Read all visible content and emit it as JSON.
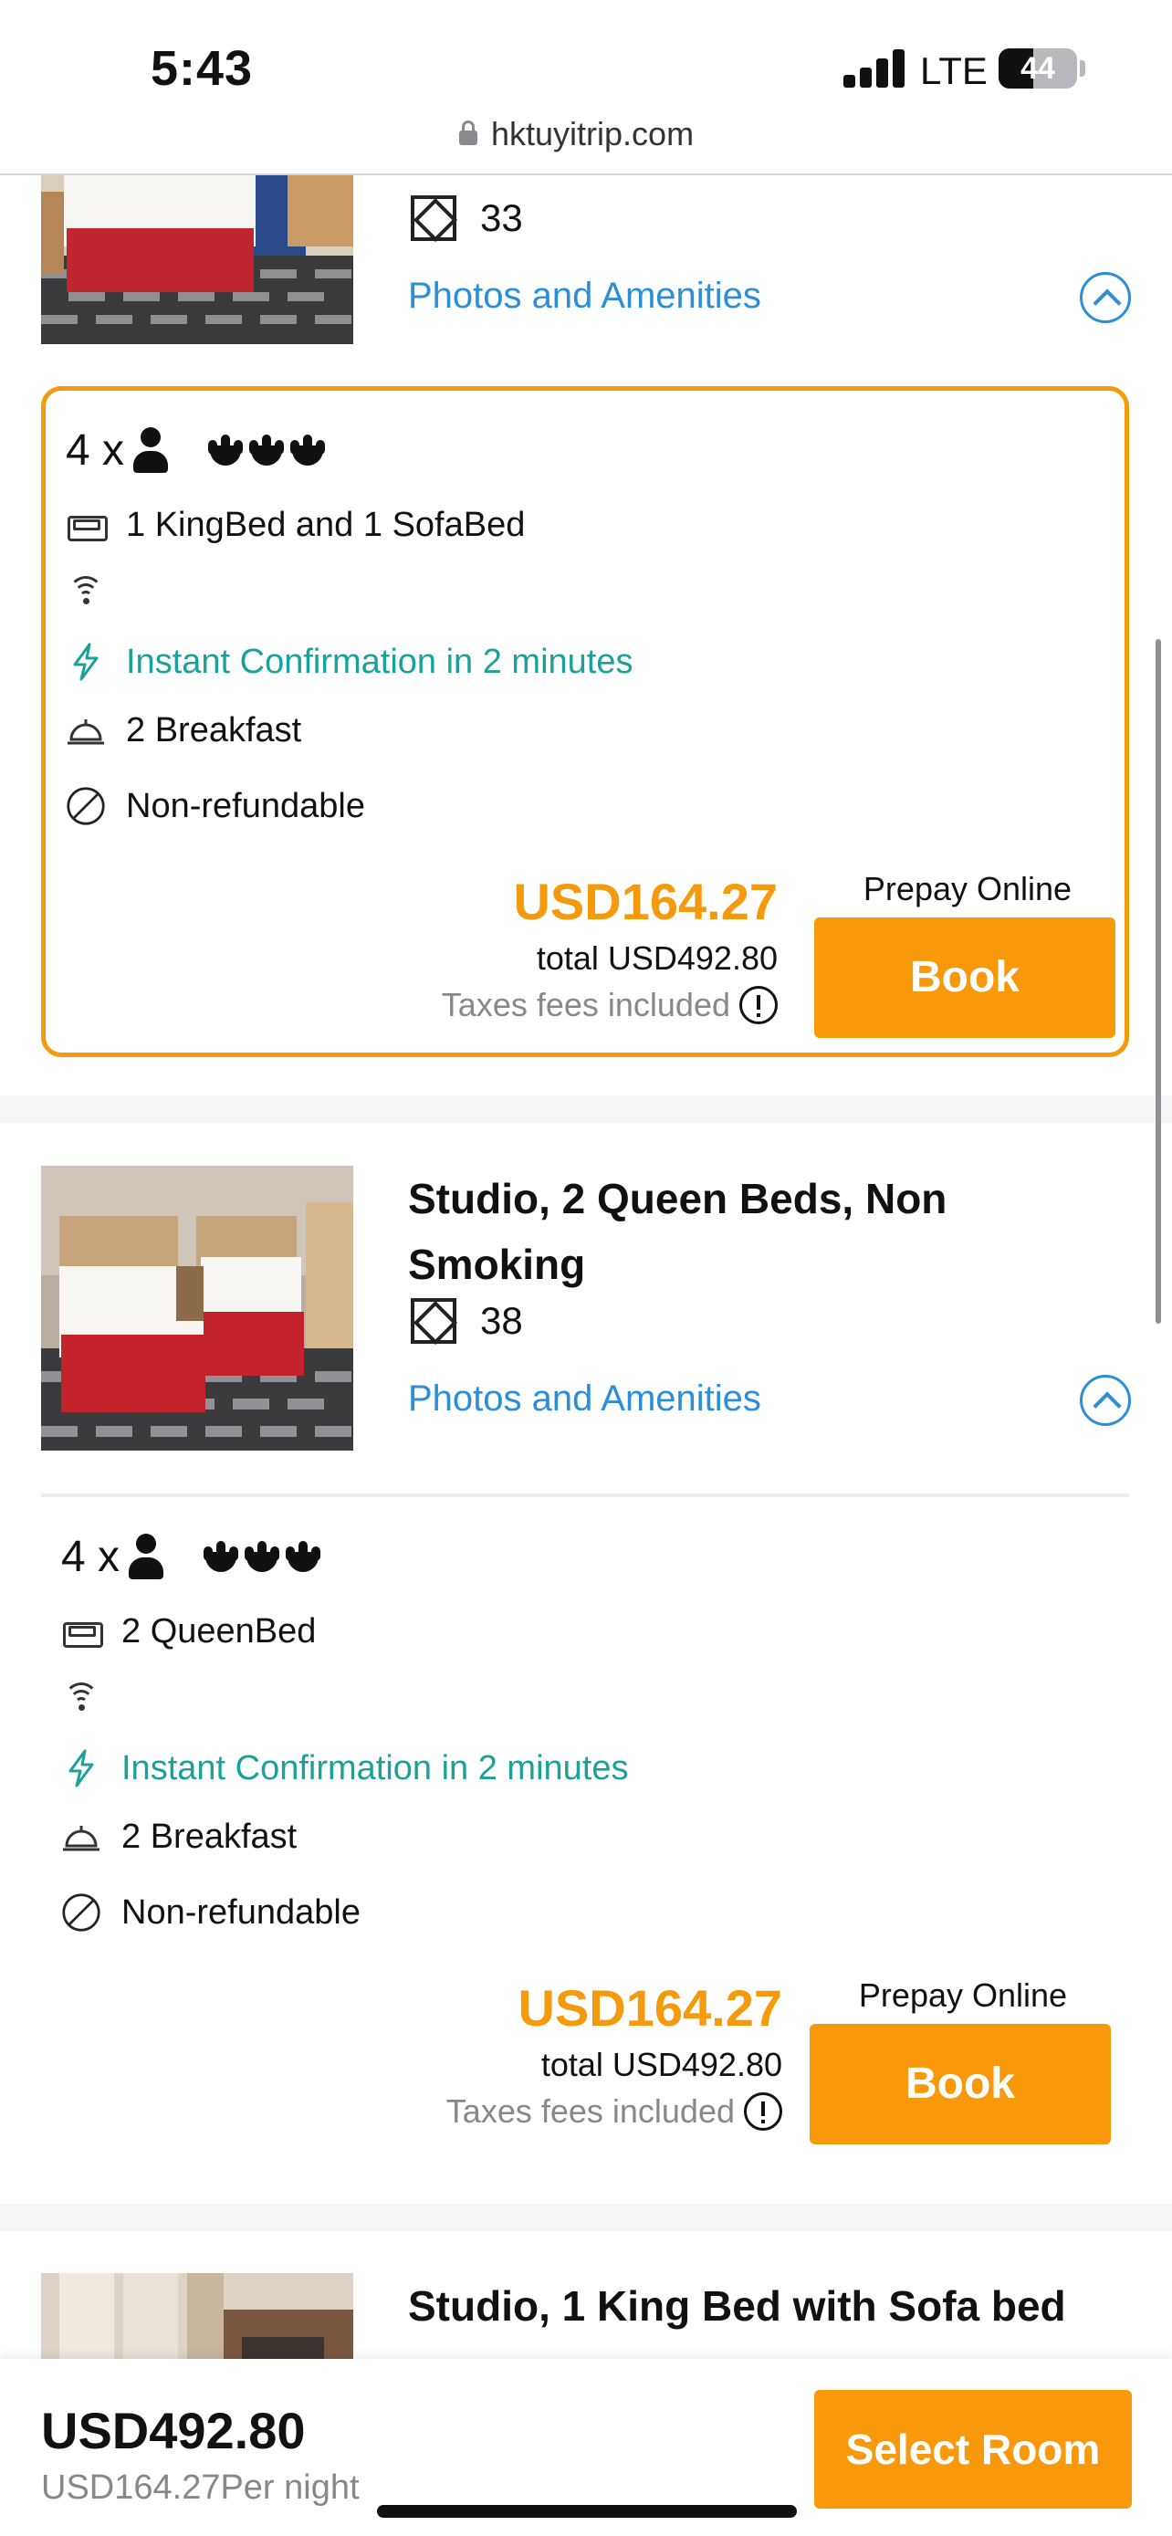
{
  "status_bar": {
    "time": "5:43",
    "network": "LTE",
    "battery": "44",
    "battery_level": 0.44
  },
  "browser": {
    "url": "hktuyitrip.com"
  },
  "rooms": [
    {
      "title": "",
      "size": "33",
      "photos_link": "Photos and Amenities",
      "offer": {
        "occupancy": "4 x",
        "bed": "1 KingBed and 1 SofaBed",
        "instant": "Instant Confirmation in 2 minutes",
        "breakfast": "2 Breakfast",
        "refund": "Non-refundable",
        "price": "USD164.27",
        "total": "total USD492.80",
        "taxes": "Taxes fees included",
        "prepay": "Prepay Online",
        "book": "Book"
      }
    },
    {
      "title": "Studio, 2 Queen Beds, Non Smoking",
      "size": "38",
      "photos_link": "Photos and Amenities",
      "offer": {
        "occupancy": "4 x",
        "bed": "2 QueenBed",
        "instant": "Instant Confirmation in 2 minutes",
        "breakfast": "2 Breakfast",
        "refund": "Non-refundable",
        "price": "USD164.27",
        "total": "total USD492.80",
        "taxes": "Taxes fees included",
        "prepay": "Prepay Online",
        "book": "Book"
      }
    },
    {
      "title": "Studio, 1 King Bed with Sofa bed"
    }
  ],
  "bottom_bar": {
    "total": "USD492.80",
    "per_night": "USD164.27Per night",
    "select": "Select Room"
  },
  "colors": {
    "accent": "#f8990b",
    "link": "#2c8ed6",
    "teal": "#1aa29a"
  }
}
